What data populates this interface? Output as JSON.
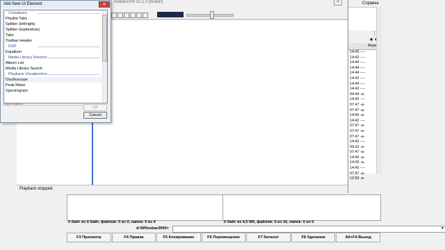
{
  "tc": {
    "right_header": [
      "Справка"
    ],
    "col_header": "Атрибу",
    "times": [
      "14:45 ----",
      "14:42 ----",
      "14:44 ----",
      "14:44 ----",
      "14:44 ----",
      "14:42 ----",
      "14:44 ----",
      "14:42 ----",
      "09:44 -a-",
      "14:42 ----",
      "07:47 -a-",
      "07:47 -a-",
      "14:06 -a-",
      "14:42 ----",
      "07:47 -a-",
      "07:47 -a-",
      "07:47 -a-",
      "14:42 ----",
      "09:32 -a-",
      "07:47 -a-",
      "14:45 -a-",
      "14:05 -a-",
      "14:42 ----",
      "07:47 -a-",
      "12:59 -a-"
    ],
    "left_stat": "0 байт из 0 байт, файлов: 0 из 0, папок: 0 из 4",
    "right_stat": "0 байт из 4,5 Мб, файлов: 0 из 16, папок: 0 из 0",
    "path": "d:\\W\\foobar2000>",
    "fkeys": [
      "F3 Просмотр",
      "F4 Правка",
      "F5 Копирование",
      "F6 Перемещение",
      "F7 Каталог",
      "F8 Удаление",
      "Alt+F4 Выход"
    ]
  },
  "foobar": {
    "title": "foobar2000 v1.1.x [foobar]",
    "status": "Playback stopped."
  },
  "dialog": {
    "title": "Add New UI Element",
    "close": "✕",
    "groups": [
      {
        "name": "Containers",
        "items": [
          "Playlist Tabs",
          "Splitter (left/right)",
          "Splitter (top/bottom)",
          "Tabs",
          "Toolbar Header"
        ]
      },
      {
        "name": "DSP",
        "items": [
          "Equalizer"
        ]
      },
      {
        "name": "Media Library Viewers",
        "items": [
          "Album List",
          "Media Library Search"
        ]
      },
      {
        "name": "Playback Visualization",
        "items": [
          "Oscilloscope",
          "Peak Meter",
          "Spectrogram"
        ]
      }
    ],
    "description_label": "Description",
    "ok": "OK",
    "cancel": "Cancel"
  }
}
